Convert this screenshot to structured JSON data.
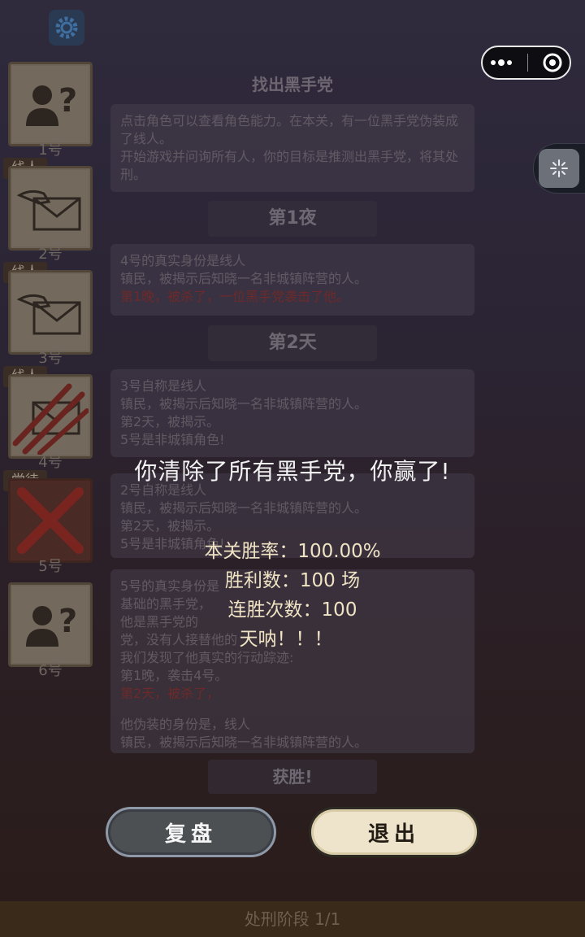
{
  "header": {
    "capsule_more_icon": "more-dots-icon",
    "capsule_close_icon": "target-close-icon"
  },
  "players": [
    {
      "num": "1号",
      "tag": "",
      "icon": "unknown-person-icon"
    },
    {
      "num": "2号",
      "tag": "线人",
      "icon": "envelope-hand-icon"
    },
    {
      "num": "3号",
      "tag": "线人",
      "icon": "envelope-hand-icon"
    },
    {
      "num": "4号",
      "tag": "线人",
      "icon": "envelope-slashed-icon"
    },
    {
      "num": "5号",
      "tag": "党徒",
      "icon": "red-x-icon"
    },
    {
      "num": "6号",
      "tag": "",
      "icon": "unknown-person-icon"
    }
  ],
  "log": {
    "title": "找出黑手党",
    "intro": [
      "点击角色可以查看角色能力。在本关，有一位黑手党伪装成了线人。",
      "开始游戏并问询所有人，你的目标是推测出黑手党，将其处刑。"
    ],
    "night1": "第1夜",
    "night1_box": [
      "4号的真实身份是线人",
      "镇民，被揭示后知晓一名非城镇阵营的人。"
    ],
    "night1_red": "第1晚，被杀了，一位黑手党袭击了他。",
    "day2": "第2天",
    "day2_box1": [
      "3号自称是线人",
      "镇民，被揭示后知晓一名非城镇阵营的人。",
      "第2天，被揭示。",
      "5号是非城镇角色!"
    ],
    "day2_box2": [
      "2号自称是线人",
      "镇民，被揭示后知晓一名非城镇阵营的人。",
      "第2天，被揭示。",
      "5号是非城镇角色!"
    ],
    "reveal_box": [
      "5号的真实身份是",
      "基础的黑手党，",
      "他是黑手党的",
      "党，没有人接替他的",
      "我们发现了他真实的行动踪迹:",
      "第1晚，袭击4号。"
    ],
    "reveal_red": "第2天，被杀了，",
    "reveal_box_tail": [
      "他伪装的身份是，线人",
      "镇民，被揭示后知晓一名非城镇阵营的人。"
    ],
    "win_label": "获胜!",
    "bottom_bar": "处刑阶段 1/1"
  },
  "result": {
    "title": "你清除了所有黑手党，你赢了!",
    "win_rate": "本关胜率：100.00%",
    "wins": "胜利数：100 场",
    "streak": "连胜次数：100",
    "exclaim": "天呐！！！",
    "replay_button": "复盘",
    "exit_button": "退出"
  }
}
